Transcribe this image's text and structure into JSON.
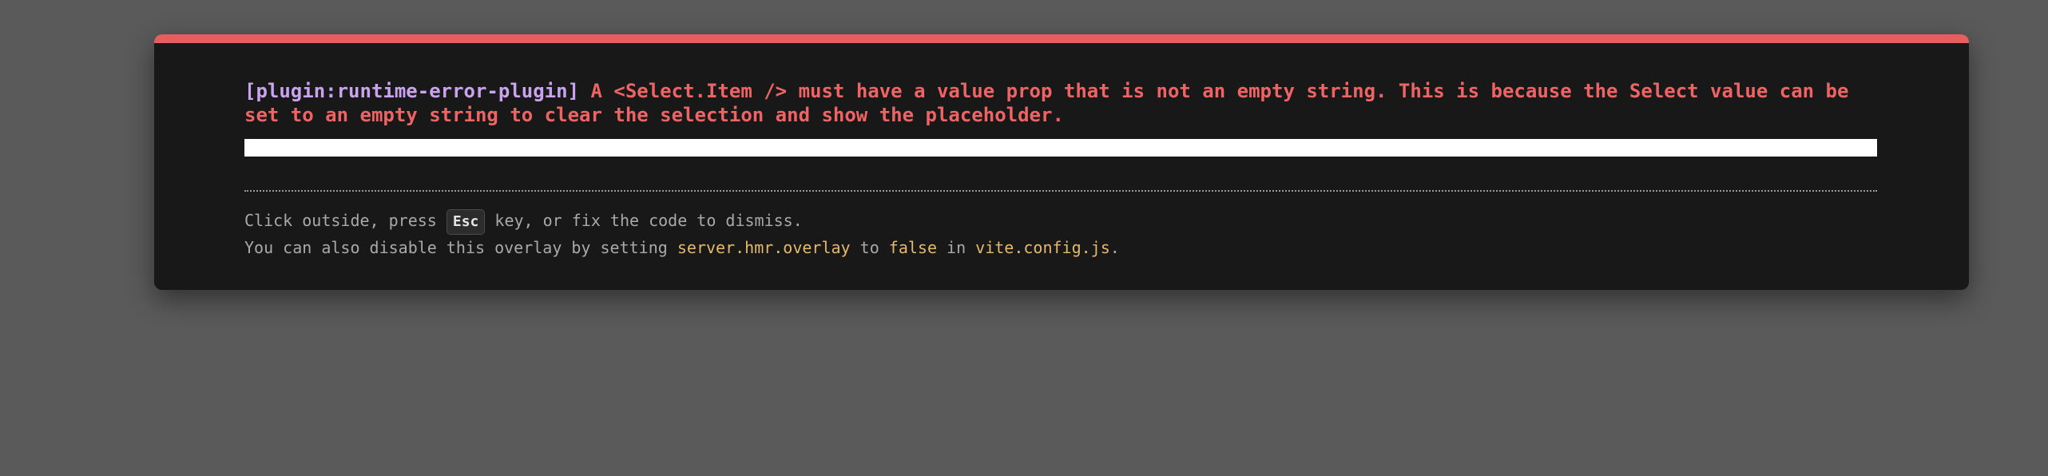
{
  "error": {
    "plugin": "[plugin:runtime-error-plugin]",
    "message": "A <Select.Item /> must have a value prop that is not an empty string. This is because the Select value can be set to an empty string to clear the selection and show the placeholder."
  },
  "tip": {
    "line1_before": "Click outside, press ",
    "key": "Esc",
    "line1_after": " key, or fix the code to dismiss.",
    "line2_before": "You can also disable this overlay by setting ",
    "config_key": "server.hmr.overlay",
    "line2_to": " to ",
    "config_value": "false",
    "line2_in": " in ",
    "config_file": "vite.config.js",
    "line2_end": "."
  },
  "colors": {
    "accent": "#e85e5e",
    "plugin_text": "#c9a3ee",
    "error_text": "#ee6464",
    "code_text": "#e4b96a",
    "backdrop": "#5a5a5a",
    "window": "#181818"
  }
}
